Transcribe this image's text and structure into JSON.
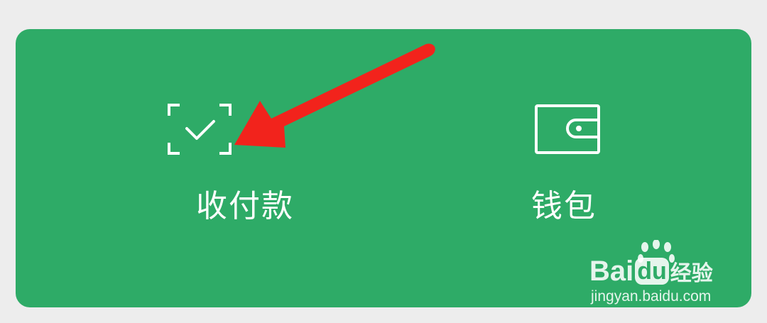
{
  "colors": {
    "background": "#ededed",
    "card": "#2eab67",
    "foreground": "#ffffff",
    "annotation_arrow": "#f2231c"
  },
  "tiles": [
    {
      "label": "收付款",
      "icon": "scan-check-icon"
    },
    {
      "label": "钱包",
      "icon": "wallet-icon"
    }
  ],
  "watermark": {
    "brand_prefix": "Bai",
    "brand_badge": "du",
    "brand_suffix": "经验",
    "url": "jingyan.baidu.com"
  }
}
